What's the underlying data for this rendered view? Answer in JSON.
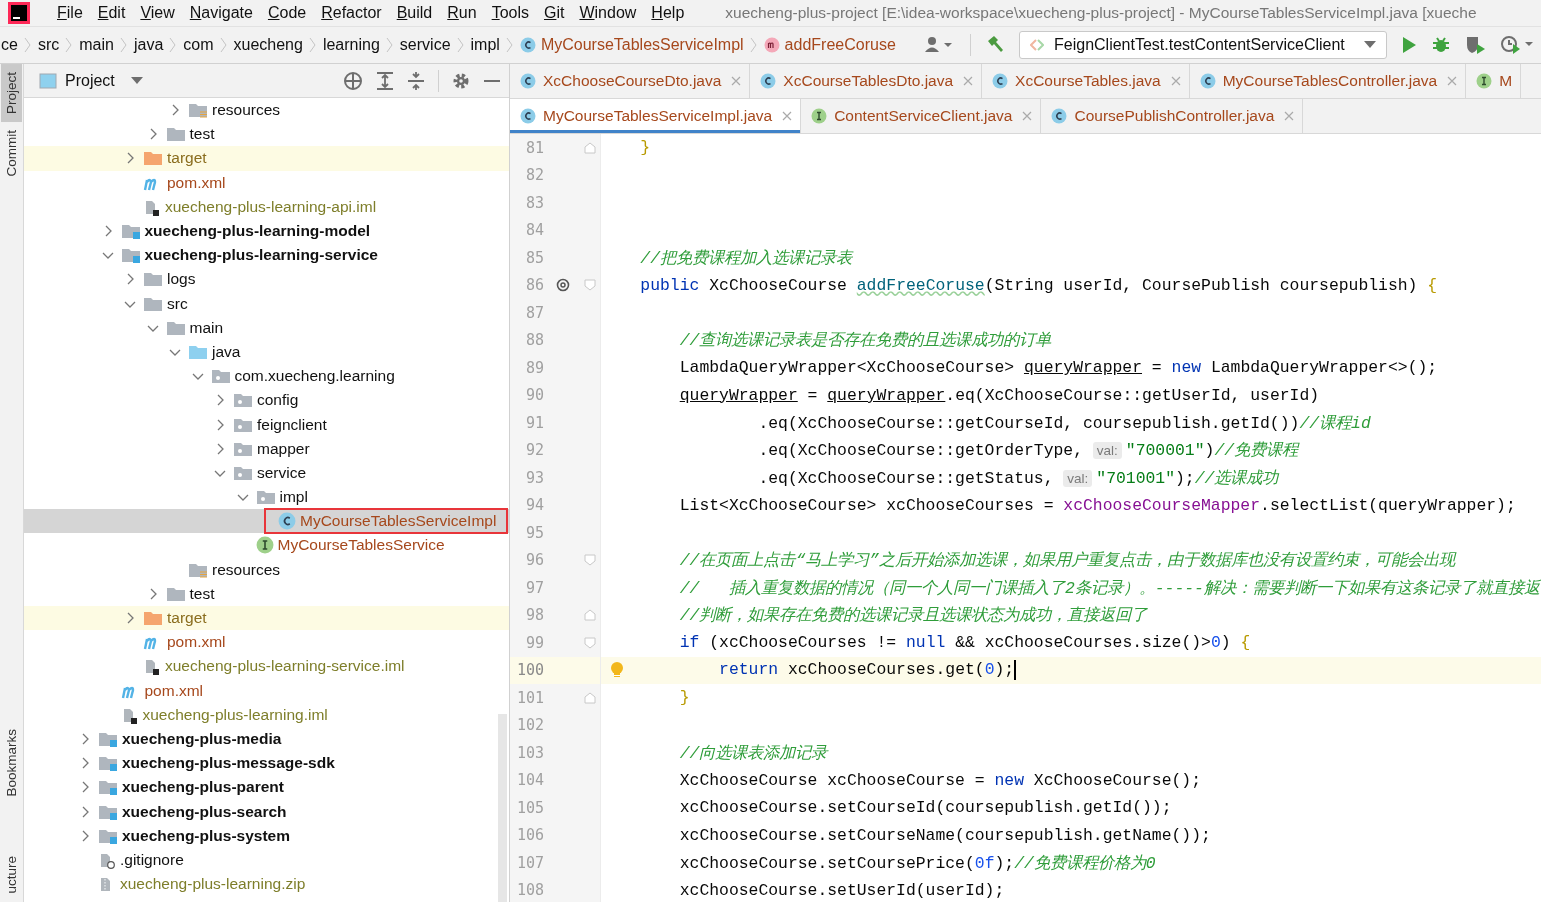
{
  "window": {
    "title": "xuecheng-plus-project [E:\\idea-workspace\\xuecheng-plus-project] - MyCourseTablesServiceImpl.java [xueche"
  },
  "menu": [
    "File",
    "Edit",
    "View",
    "Navigate",
    "Code",
    "Refactor",
    "Build",
    "Run",
    "Tools",
    "Git",
    "Window",
    "Help"
  ],
  "breadcrumbs": [
    {
      "label": "ce",
      "kind": "folder"
    },
    {
      "label": "src",
      "kind": "folder"
    },
    {
      "label": "main",
      "kind": "folder"
    },
    {
      "label": "java",
      "kind": "folder"
    },
    {
      "label": "com",
      "kind": "folder"
    },
    {
      "label": "xuecheng",
      "kind": "folder"
    },
    {
      "label": "learning",
      "kind": "folder"
    },
    {
      "label": "service",
      "kind": "folder"
    },
    {
      "label": "impl",
      "kind": "folder"
    },
    {
      "label": "MyCourseTablesServiceImpl",
      "kind": "class"
    },
    {
      "label": "addFreeCoruse",
      "kind": "method"
    }
  ],
  "run_config": "FeignClientTest.testContentServiceClient",
  "tool_stripe": [
    {
      "label": "Project",
      "selected": true
    },
    {
      "label": "Commit",
      "selected": false
    },
    {
      "label": "Bookmarks",
      "selected": false
    },
    {
      "label": "ucture",
      "selected": false
    }
  ],
  "project_panel": {
    "title": "Project",
    "tree": [
      {
        "children": [
          {
            "children": [
              {
                "children": [
                  {
                    "children": [
                      {
                        "label": "resources",
                        "kind": "resources",
                        "expanded": false,
                        "selected": false
                      }
                    ]
                  },
                  {
                    "label": "test",
                    "kind": "folder",
                    "expanded": false,
                    "selected": false
                  }
                ]
              },
              {
                "label": "target",
                "kind": "excluded",
                "expanded": false,
                "selected": false
              },
              {
                "label": "pom.xml",
                "kind": "pom",
                "selected": false
              },
              {
                "label": "xuecheng-plus-learning-api.iml",
                "kind": "iml",
                "selected": false
              }
            ]
          },
          {
            "label": "xuecheng-plus-learning-model",
            "kind": "module",
            "expanded": false,
            "selected": false
          },
          {
            "label": "xuecheng-plus-learning-service",
            "kind": "module",
            "expanded": true,
            "selected": false,
            "children": [
              {
                "label": "logs",
                "kind": "folder",
                "expanded": false,
                "selected": false
              },
              {
                "label": "src",
                "kind": "folder",
                "expanded": true,
                "selected": false,
                "children": [
                  {
                    "label": "main",
                    "kind": "folder",
                    "expanded": true,
                    "selected": false,
                    "children": [
                      {
                        "label": "java",
                        "kind": "source",
                        "expanded": true,
                        "selected": false,
                        "children": [
                          {
                            "label": "com.xuecheng.learning",
                            "kind": "package",
                            "expanded": true,
                            "selected": false,
                            "children": [
                              {
                                "label": "config",
                                "kind": "package",
                                "expanded": false,
                                "selected": false
                              },
                              {
                                "label": "feignclient",
                                "kind": "package",
                                "expanded": false,
                                "selected": false
                              },
                              {
                                "label": "mapper",
                                "kind": "package",
                                "expanded": false,
                                "selected": false
                              },
                              {
                                "label": "service",
                                "kind": "package",
                                "expanded": true,
                                "selected": false,
                                "children": [
                                  {
                                    "label": "impl",
                                    "kind": "package",
                                    "expanded": true,
                                    "selected": false,
                                    "children": [
                                      {
                                        "label": "MyCourseTablesServiceImpl",
                                        "kind": "class",
                                        "selected": true
                                      }
                                    ]
                                  },
                                  {
                                    "label": "MyCourseTablesService",
                                    "kind": "interface",
                                    "selected": false
                                  }
                                ]
                              }
                            ]
                          }
                        ]
                      },
                      {
                        "label": "resources",
                        "kind": "resources",
                        "selected": false
                      }
                    ]
                  },
                  {
                    "label": "test",
                    "kind": "folder",
                    "expanded": false,
                    "selected": false
                  }
                ]
              },
              {
                "label": "target",
                "kind": "excluded",
                "expanded": false,
                "selected": false
              },
              {
                "label": "pom.xml",
                "kind": "pom",
                "selected": false
              },
              {
                "label": "xuecheng-plus-learning-service.iml",
                "kind": "iml",
                "selected": false
              }
            ]
          },
          {
            "label": "pom.xml",
            "kind": "pom",
            "selected": false
          },
          {
            "label": "xuecheng-plus-learning.iml",
            "kind": "iml",
            "selected": false
          }
        ]
      },
      {
        "label": "xuecheng-plus-media",
        "kind": "module",
        "expanded": false,
        "selected": false
      },
      {
        "label": "xuecheng-plus-message-sdk",
        "kind": "module",
        "expanded": false,
        "selected": false
      },
      {
        "label": "xuecheng-plus-parent",
        "kind": "module",
        "expanded": false,
        "selected": false
      },
      {
        "label": "xuecheng-plus-search",
        "kind": "module",
        "expanded": false,
        "selected": false
      },
      {
        "label": "xuecheng-plus-system",
        "kind": "module",
        "expanded": false,
        "selected": false
      },
      {
        "label": ".gitignore",
        "kind": "ignore",
        "selected": false
      },
      {
        "label": "xuecheng-plus-learning.zip",
        "kind": "zip",
        "selected": false
      }
    ]
  },
  "editor_tabs": [
    [
      {
        "label": "XcChooseCourseDto.java",
        "kind": "class",
        "selected": false
      },
      {
        "label": "XcCourseTablesDto.java",
        "kind": "class",
        "selected": false
      },
      {
        "label": "XcCourseTables.java",
        "kind": "class",
        "selected": false
      },
      {
        "label": "MyCourseTablesController.java",
        "kind": "class",
        "selected": false
      },
      {
        "label": "M",
        "kind": "interface",
        "selected": false
      }
    ],
    [
      {
        "label": "MyCourseTablesServiceImpl.java",
        "kind": "class",
        "selected": true
      },
      {
        "label": "ContentServiceClient.java",
        "kind": "interface",
        "selected": false
      },
      {
        "label": "CoursePublishController.java",
        "kind": "class",
        "selected": false
      }
    ]
  ],
  "code": [
    {
      "n": "81",
      "current": false,
      "gutter": [
        {
          "kind": "fold_end"
        }
      ],
      "tokens": [
        {
          "kind": "brace",
          "t": "    }"
        }
      ]
    },
    {
      "n": "82",
      "current": false
    },
    {
      "n": "83",
      "current": false
    },
    {
      "n": "84",
      "current": false
    },
    {
      "n": "85",
      "current": false,
      "tokens": [
        {
          "kind": "cmt",
          "t": "    //把免费课程加入选课记录表"
        }
      ]
    },
    {
      "n": "86",
      "current": false,
      "gutter": [
        {
          "kind": "override"
        },
        {
          "kind": "fold_start"
        }
      ],
      "tokens": [
        {
          "kind": "kw",
          "t": "    public"
        },
        {
          "kind": "plain",
          "t": " XcChooseCourse "
        },
        {
          "kind": "fn",
          "t": "addFreeCoruse"
        },
        {
          "kind": "plain",
          "t": "(String userId, CoursePublish coursepublish) "
        },
        {
          "kind": "brace",
          "t": "{"
        }
      ]
    },
    {
      "n": "87",
      "current": false
    },
    {
      "n": "88",
      "current": false,
      "tokens": [
        {
          "kind": "cmt",
          "t": "        //查询选课记录表是否存在免费的且选课成功的订单"
        }
      ]
    },
    {
      "n": "89",
      "current": false,
      "tokens": [
        {
          "kind": "plain",
          "t": "        LambdaQueryWrapper<XcChooseCourse> "
        },
        {
          "kind": "ul",
          "t": "queryWrapper"
        },
        {
          "kind": "plain",
          "t": " = "
        },
        {
          "kind": "kw",
          "t": "new"
        },
        {
          "kind": "plain",
          "t": " LambdaQueryWrapper<>();"
        }
      ]
    },
    {
      "n": "90",
      "current": false,
      "tokens": [
        {
          "kind": "ul",
          "t": "        queryWrapper"
        },
        {
          "kind": "plain",
          "t": " = "
        },
        {
          "kind": "ul",
          "t": "queryWrapper"
        },
        {
          "kind": "plain",
          "t": ".eq(XcChooseCourse::getUserId, userId)"
        }
      ]
    },
    {
      "n": "91",
      "current": false,
      "tokens": [
        {
          "kind": "plain",
          "t": "                .eq(XcChooseCourse::getCourseId, coursepublish.getId())"
        },
        {
          "kind": "cmt",
          "t": "//课程id"
        }
      ]
    },
    {
      "n": "92",
      "current": false,
      "tokens": [
        {
          "kind": "plain",
          "t": "                .eq(XcChooseCourse::getOrderType, "
        },
        {
          "kind": "hint",
          "t": "val:"
        },
        {
          "kind": "str",
          "t": "\"700001\""
        },
        {
          "kind": "plain",
          "t": ")"
        },
        {
          "kind": "cmt",
          "t": "//免费课程"
        }
      ]
    },
    {
      "n": "93",
      "current": false,
      "tokens": [
        {
          "kind": "plain",
          "t": "                .eq(XcChooseCourse::getStatus, "
        },
        {
          "kind": "hint",
          "t": "val:"
        },
        {
          "kind": "str",
          "t": "\"701001\""
        },
        {
          "kind": "plain",
          "t": ");"
        },
        {
          "kind": "cmt",
          "t": "//选课成功"
        }
      ]
    },
    {
      "n": "94",
      "current": false,
      "tokens": [
        {
          "kind": "plain",
          "t": "        List<XcChooseCourse> xcChooseCourses = "
        },
        {
          "kind": "field",
          "t": "xcChooseCourseMapper"
        },
        {
          "kind": "plain",
          "t": ".selectList(queryWrapper);"
        }
      ]
    },
    {
      "n": "95",
      "current": false
    },
    {
      "n": "96",
      "current": false,
      "gutter": [
        {
          "kind": "fold_start"
        }
      ],
      "tokens": [
        {
          "kind": "cmt",
          "t": "        //在页面上点击“马上学习”之后开始添加选课，如果用户重复点击，由于数据库也没有设置约束，可能会出现"
        }
      ]
    },
    {
      "n": "97",
      "current": false,
      "tokens": [
        {
          "kind": "cmt",
          "t": "        //   插入重复数据的情况（同一个人同一门课插入了2条记录）。-----解决：需要判断一下如果有这条记录了就直接返"
        }
      ]
    },
    {
      "n": "98",
      "current": false,
      "gutter": [
        {
          "kind": "fold_end"
        }
      ],
      "tokens": [
        {
          "kind": "cmt",
          "t": "        //判断，如果存在免费的选课记录且选课状态为成功，直接返回了"
        }
      ]
    },
    {
      "n": "99",
      "current": false,
      "gutter": [
        {
          "kind": "fold_start"
        }
      ],
      "tokens": [
        {
          "kind": "kw",
          "t": "        if"
        },
        {
          "kind": "plain",
          "t": " (xcChooseCourses != "
        },
        {
          "kind": "kw",
          "t": "null"
        },
        {
          "kind": "plain",
          "t": " && xcChooseCourses.size()>"
        },
        {
          "kind": "num",
          "t": "0"
        },
        {
          "kind": "plain",
          "t": ") "
        },
        {
          "kind": "brace",
          "t": "{"
        }
      ]
    },
    {
      "n": "100",
      "current": true,
      "gutter": [
        {
          "kind": "bulb"
        }
      ],
      "tokens": [
        {
          "kind": "kw",
          "t": "            return"
        },
        {
          "kind": "plain",
          "t": " xcChooseCourses.get("
        },
        {
          "kind": "num",
          "t": "0"
        },
        {
          "kind": "plain",
          "t": ");"
        }
      ]
    },
    {
      "n": "101",
      "current": false,
      "gutter": [
        {
          "kind": "fold_end"
        }
      ],
      "tokens": [
        {
          "kind": "brace",
          "t": "        }"
        }
      ]
    },
    {
      "n": "102",
      "current": false
    },
    {
      "n": "103",
      "current": false,
      "tokens": [
        {
          "kind": "cmt",
          "t": "        //向选课表添加记录"
        }
      ]
    },
    {
      "n": "104",
      "current": false,
      "tokens": [
        {
          "kind": "plain",
          "t": "        XcChooseCourse xcChooseCourse = "
        },
        {
          "kind": "kw",
          "t": "new"
        },
        {
          "kind": "plain",
          "t": " XcChooseCourse();"
        }
      ]
    },
    {
      "n": "105",
      "current": false,
      "tokens": [
        {
          "kind": "plain",
          "t": "        xcChooseCourse.setCourseId(coursepublish.getId());"
        }
      ]
    },
    {
      "n": "106",
      "current": false,
      "tokens": [
        {
          "kind": "plain",
          "t": "        xcChooseCourse.setCourseName(coursepublish.getName());"
        }
      ]
    },
    {
      "n": "107",
      "current": false,
      "tokens": [
        {
          "kind": "plain",
          "t": "        xcChooseCourse.setCoursePrice("
        },
        {
          "kind": "num",
          "t": "0f"
        },
        {
          "kind": "plain",
          "t": ");"
        },
        {
          "kind": "cmt",
          "t": "//免费课程价格为0"
        }
      ]
    },
    {
      "n": "108",
      "current": false,
      "tokens": [
        {
          "kind": "plain",
          "t": "        xcChooseCourse.setUserId(userId);"
        }
      ]
    }
  ]
}
